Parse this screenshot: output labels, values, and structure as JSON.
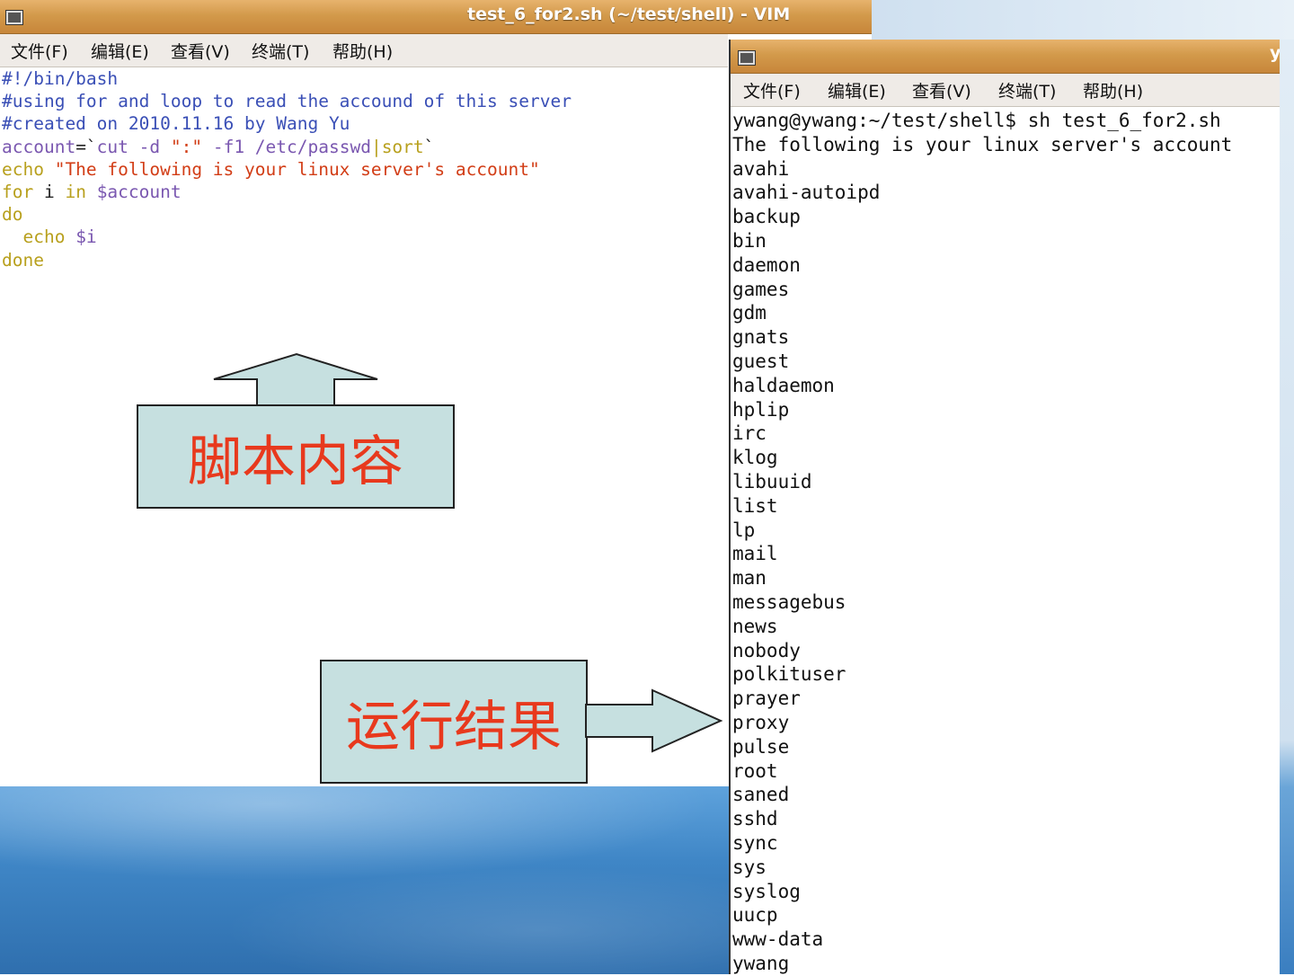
{
  "vim": {
    "title": "test_6_for2.sh (~/test/shell) - VIM",
    "menu": [
      "文件(F)",
      "编辑(E)",
      "查看(V)",
      "终端(T)",
      "帮助(H)"
    ],
    "code": {
      "line1": "#!/bin/bash",
      "line2": "#using for and loop to read the accound of this server",
      "line3": "#created on 2010.11.16 by Wang Yu",
      "line4_a": "account",
      "line4_b": "=`",
      "line4_c": "cut -d ",
      "line4_d": "\":\"",
      "line4_e": " -f1 /etc/passwd",
      "line4_f": "|",
      "line4_g": "sort",
      "line4_h": "`",
      "line5_a": "echo ",
      "line5_b": "\"The following is your linux server's account\"",
      "line6_a": "for",
      "line6_b": " i ",
      "line6_c": "in",
      "line6_d": " $account",
      "line7": "do",
      "line8_a": "  echo",
      "line8_b": " $i",
      "line9": "done"
    }
  },
  "terminal": {
    "title": "y",
    "menu": [
      "文件(F)",
      "编辑(E)",
      "查看(V)",
      "终端(T)",
      "帮助(H)"
    ],
    "lines": [
      "ywang@ywang:~/test/shell$ sh test_6_for2.sh",
      "The following is your linux server's account",
      "avahi",
      "avahi-autoipd",
      "backup",
      "bin",
      "daemon",
      "games",
      "gdm",
      "gnats",
      "guest",
      "haldaemon",
      "hplip",
      "irc",
      "klog",
      "libuuid",
      "list",
      "lp",
      "mail",
      "man",
      "messagebus",
      "news",
      "nobody",
      "polkituser",
      "prayer",
      "proxy",
      "pulse",
      "root",
      "saned",
      "sshd",
      "sync",
      "sys",
      "syslog",
      "uucp",
      "www-data",
      "ywang"
    ]
  },
  "annotations": {
    "script_label": "脚本内容",
    "result_label": "运行结果",
    "fill_color": "#c6e0e0",
    "text_color": "#e8391d"
  }
}
